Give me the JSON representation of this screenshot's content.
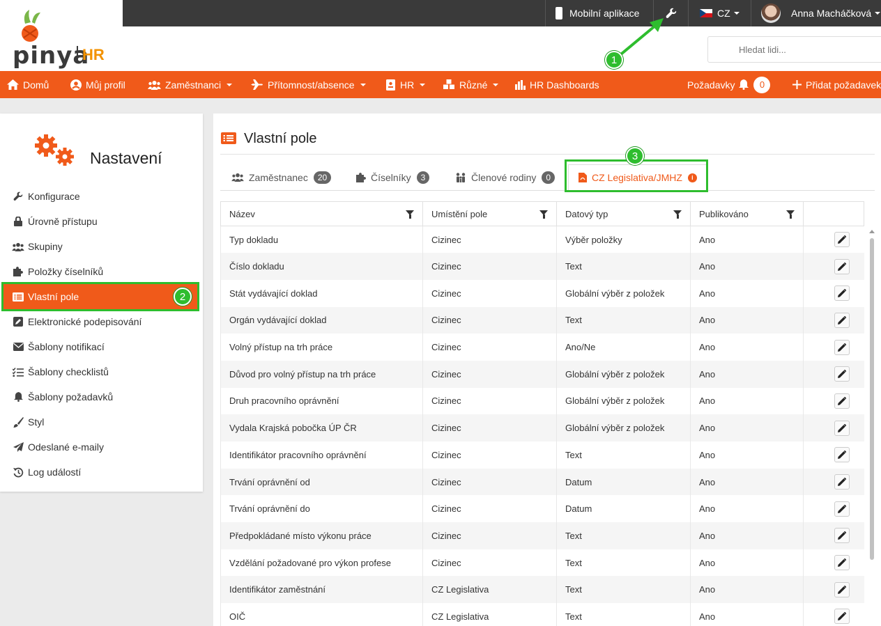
{
  "topbar": {
    "mobile_label": "Mobilní aplikace",
    "lang": "CZ",
    "user_name": "Anna Macháčková"
  },
  "logo": {
    "brand": "pinya",
    "suffix": "HR"
  },
  "search": {
    "placeholder": "Hledat lidi..."
  },
  "nav": {
    "items": [
      {
        "label": "Domů",
        "icon": "home-icon"
      },
      {
        "label": "Můj profil",
        "icon": "user-circle-icon"
      },
      {
        "label": "Zaměstnanci",
        "icon": "users-icon",
        "dropdown": true
      },
      {
        "label": "Přítomnost/absence",
        "icon": "plane-icon",
        "dropdown": true
      },
      {
        "label": "HR",
        "icon": "id-card-icon",
        "dropdown": true
      },
      {
        "label": "Různé",
        "icon": "cubes-icon",
        "dropdown": true
      },
      {
        "label": "HR Dashboards",
        "icon": "bar-chart-icon"
      }
    ],
    "requests_label": "Požadavky",
    "requests_count": "0",
    "add_request_label": "Přidat požadavek"
  },
  "markers": {
    "m1": "1",
    "m2": "2",
    "m3": "3"
  },
  "sidebar": {
    "title": "Nastavení",
    "items": [
      {
        "label": "Konfigurace",
        "icon": "wrench-icon"
      },
      {
        "label": "Úrovně přístupu",
        "icon": "lock-icon"
      },
      {
        "label": "Skupiny",
        "icon": "users-icon"
      },
      {
        "label": "Položky číselníků",
        "icon": "puzzle-icon"
      },
      {
        "label": "Vlastní pole",
        "icon": "list-icon",
        "active": true
      },
      {
        "label": "Elektronické podepisování",
        "icon": "signature-icon"
      },
      {
        "label": "Šablony notifikací",
        "icon": "envelope-icon"
      },
      {
        "label": "Šablony checklistů",
        "icon": "checklist-icon"
      },
      {
        "label": "Šablony požadavků",
        "icon": "bell-icon"
      },
      {
        "label": "Styl",
        "icon": "brush-icon"
      },
      {
        "label": "Odeslané e-maily",
        "icon": "paper-plane-icon"
      },
      {
        "label": "Log událostí",
        "icon": "history-icon"
      }
    ]
  },
  "main": {
    "title": "Vlastní pole",
    "tabs": [
      {
        "label": "Zaměstnanec",
        "count": "20",
        "icon": "users-icon"
      },
      {
        "label": "Číselníky",
        "count": "3",
        "icon": "puzzle-icon"
      },
      {
        "label": "Členové rodiny",
        "count": "0",
        "icon": "family-icon"
      },
      {
        "label": "CZ Legislativa/JMHZ",
        "icon": "file-pdf-icon",
        "active": true
      }
    ],
    "table": {
      "columns": [
        "Název",
        "Umístění pole",
        "Datový typ",
        "Publikováno"
      ],
      "rows": [
        [
          "Typ dokladu",
          "Cizinec",
          "Výběr položky",
          "Ano"
        ],
        [
          "Číslo dokladu",
          "Cizinec",
          "Text",
          "Ano"
        ],
        [
          "Stát vydávající doklad",
          "Cizinec",
          "Globální výběr z položek",
          "Ano"
        ],
        [
          "Orgán vydávající doklad",
          "Cizinec",
          "Text",
          "Ano"
        ],
        [
          "Volný přístup na trh práce",
          "Cizinec",
          "Ano/Ne",
          "Ano"
        ],
        [
          "Důvod pro volný přístup na trh práce",
          "Cizinec",
          "Globální výběr z položek",
          "Ano"
        ],
        [
          "Druh pracovního oprávnění",
          "Cizinec",
          "Globální výběr z položek",
          "Ano"
        ],
        [
          "Vydala Krajská pobočka ÚP ČR",
          "Cizinec",
          "Globální výběr z položek",
          "Ano"
        ],
        [
          "Identifikátor pracovního oprávnění",
          "Cizinec",
          "Text",
          "Ano"
        ],
        [
          "Trvání oprávnění od",
          "Cizinec",
          "Datum",
          "Ano"
        ],
        [
          "Trvání oprávnění do",
          "Cizinec",
          "Datum",
          "Ano"
        ],
        [
          "Předpokládané místo výkonu práce",
          "Cizinec",
          "Text",
          "Ano"
        ],
        [
          "Vzdělání požadované pro výkon profese",
          "Cizinec",
          "Text",
          "Ano"
        ],
        [
          "Identifikátor zaměstnání",
          "CZ Legislativa",
          "Text",
          "Ano"
        ],
        [
          "OIČ",
          "CZ Legislativa",
          "Text",
          "Ano"
        ]
      ]
    }
  },
  "colors": {
    "accent": "#f05a1a",
    "topbar": "#3a3a3a",
    "annotation": "#2ebd2e"
  }
}
